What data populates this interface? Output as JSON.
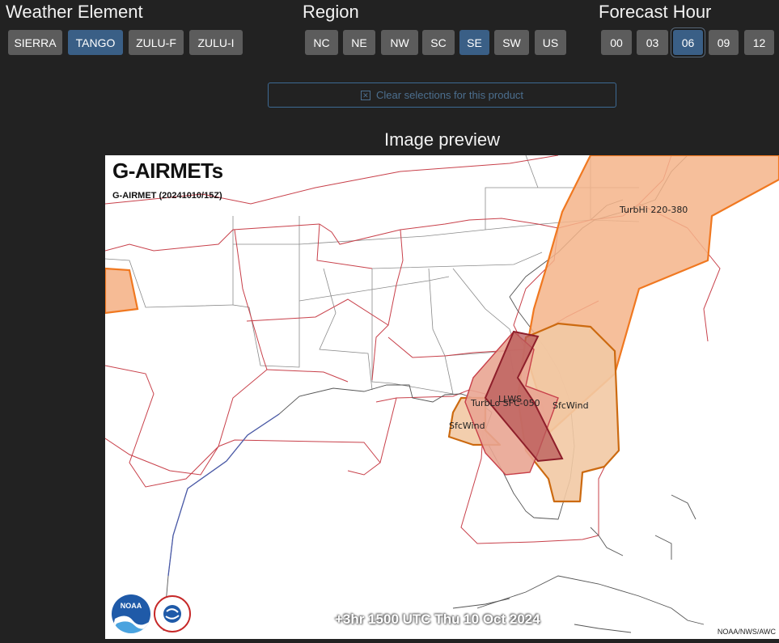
{
  "groups": {
    "weather_element": {
      "title": "Weather Element",
      "options": [
        "SIERRA",
        "TANGO",
        "ZULU-F",
        "ZULU-I"
      ],
      "selected": "TANGO"
    },
    "region": {
      "title": "Region",
      "options": [
        "NC",
        "NE",
        "NW",
        "SC",
        "SE",
        "SW",
        "US"
      ],
      "selected": "SE"
    },
    "forecast_hour": {
      "title": "Forecast Hour",
      "options": [
        "00",
        "03",
        "06",
        "09",
        "12"
      ],
      "selected": "06"
    }
  },
  "clear_button": {
    "icon": "x-box-icon",
    "label": "Clear selections for this product"
  },
  "preview": {
    "title": "Image preview",
    "map": {
      "heading": "G-AIRMETs",
      "subheading": "G-AIRMET (20241010/15Z)",
      "footer_time": "+3hr 1500 UTC Thu 10 Oct 2024",
      "credit": "NOAA/NWS/AWC",
      "logo_noaa": "NOAA",
      "area_labels": {
        "turb_hi": "TurbHi 220-380",
        "llws": "LLWS",
        "turb_lo": "TurbLo SFC-050",
        "sfc_wind_east": "SfcWind",
        "sfc_wind_west": "SfcWind"
      }
    }
  },
  "colors": {
    "background": "#222222",
    "button": "#5c5c5c",
    "button_selected": "#3a5f86",
    "turb_fill": "#f5b48a",
    "turb_stroke": "#f07820",
    "llws_fill": "#c46a6a",
    "llws_stroke": "#8e1e2a",
    "sfcwind_fill": "#f2c9a4",
    "sfcwind_stroke": "#cc6a10",
    "boundary_red": "#c8404a"
  }
}
